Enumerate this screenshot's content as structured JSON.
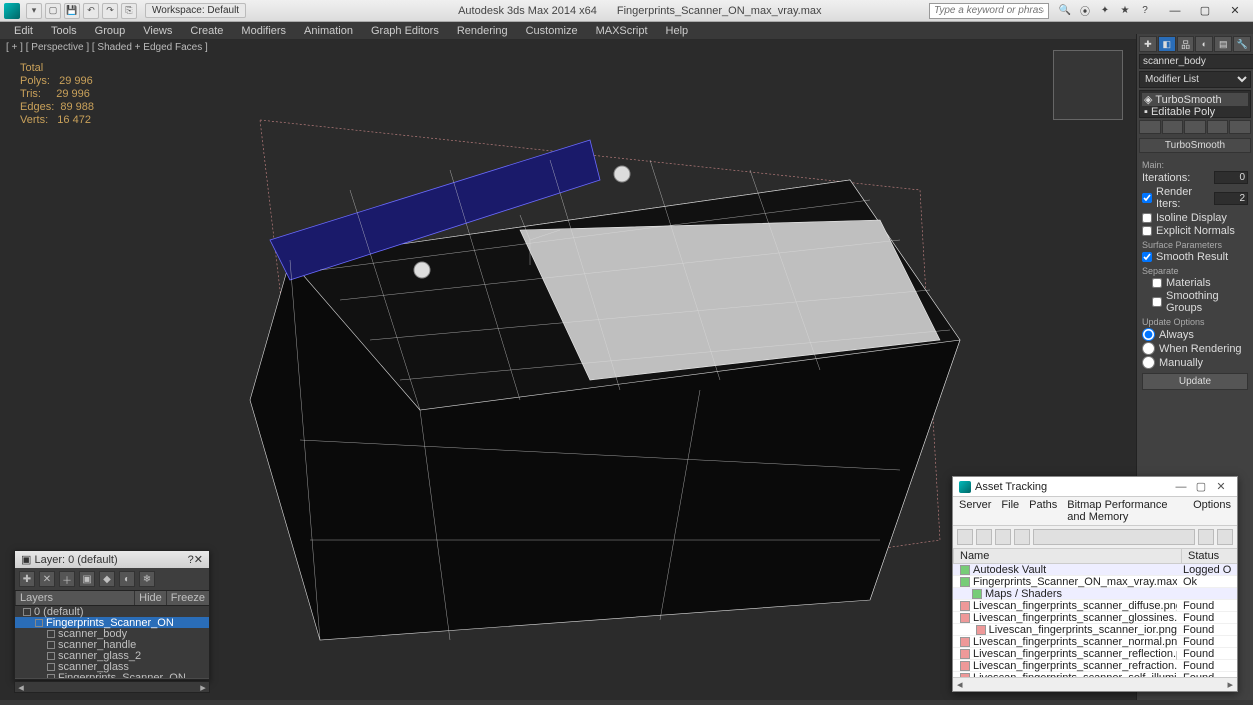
{
  "title": {
    "app": "Autodesk 3ds Max  2014 x64",
    "file": "Fingerprints_Scanner_ON_max_vray.max",
    "workspace": "Workspace: Default",
    "search_ph": "Type a keyword or phrase"
  },
  "menu": [
    "Edit",
    "Tools",
    "Group",
    "Views",
    "Create",
    "Modifiers",
    "Animation",
    "Graph Editors",
    "Rendering",
    "Customize",
    "MAXScript",
    "Help"
  ],
  "viewport": {
    "label": "[ + ] [ Perspective ] [ Shaded + Edged Faces ]"
  },
  "stats": {
    "heading": "Total",
    "polys": "Polys:   29 996",
    "tris": "Tris:     29 996",
    "edges": "Edges:  89 988",
    "verts": "Verts:   16 472"
  },
  "modpanel": {
    "objname": "scanner_body",
    "modlist": "Modifier List",
    "stack": [
      "TurboSmooth",
      "Editable Poly"
    ],
    "rollup": "TurboSmooth",
    "main": "Main:",
    "iter_lbl": "Iterations:",
    "iter_val": "0",
    "riter_lbl": "Render Iters:",
    "riter_val": "2",
    "isoline": "Isoline Display",
    "explicit": "Explicit Normals",
    "surf_hd": "Surface Parameters",
    "smooth": "Smooth Result",
    "separate": "Separate",
    "sep_mat": "Materials",
    "sep_sg": "Smoothing Groups",
    "upd_hd": "Update Options",
    "upd_always": "Always",
    "upd_render": "When Rendering",
    "upd_manual": "Manually",
    "upd_btn": "Update"
  },
  "layers": {
    "title": "Layer: 0 (default)",
    "col_layers": "Layers",
    "col_hide": "Hide",
    "col_freeze": "Freeze",
    "items": [
      {
        "name": "0 (default)",
        "indent": 0
      },
      {
        "name": "Fingerprints_Scanner_ON",
        "indent": 1,
        "sel": true
      },
      {
        "name": "scanner_body",
        "indent": 2
      },
      {
        "name": "scanner_handle",
        "indent": 2
      },
      {
        "name": "scanner_glass_2",
        "indent": 2
      },
      {
        "name": "scanner_glass",
        "indent": 2
      },
      {
        "name": "Fingerprints_Scanner_ON",
        "indent": 2
      }
    ]
  },
  "asset": {
    "title": "Asset Tracking",
    "menu": [
      "Server",
      "File",
      "Paths",
      "Bitmap Performance and Memory",
      "Options"
    ],
    "col_name": "Name",
    "col_status": "Status",
    "rows": [
      {
        "name": "Autodesk Vault",
        "status": "Logged O",
        "cls": "hdr",
        "icon": "g",
        "ind": 0
      },
      {
        "name": "Fingerprints_Scanner_ON_max_vray.max",
        "status": "Ok",
        "icon": "g",
        "ind": 1
      },
      {
        "name": "Maps / Shaders",
        "status": "",
        "cls": "hdr",
        "icon": "g",
        "ind": 1
      },
      {
        "name": "Livescan_fingerprints_scanner_diffuse.png",
        "status": "Found",
        "icon": "r",
        "ind": 2
      },
      {
        "name": "Livescan_fingerprints_scanner_glossines.png",
        "status": "Found",
        "icon": "r",
        "ind": 2
      },
      {
        "name": "Livescan_fingerprints_scanner_ior.png",
        "status": "Found",
        "icon": "r",
        "ind": 2
      },
      {
        "name": "Livescan_fingerprints_scanner_normal.png",
        "status": "Found",
        "icon": "r",
        "ind": 2
      },
      {
        "name": "Livescan_fingerprints_scanner_reflection.png",
        "status": "Found",
        "icon": "r",
        "ind": 2
      },
      {
        "name": "Livescan_fingerprints_scanner_refraction.png",
        "status": "Found",
        "icon": "r",
        "ind": 2
      },
      {
        "name": "Livescan_fingerprints_scanner_self_illumination.png",
        "status": "Found",
        "icon": "r",
        "ind": 2
      }
    ]
  }
}
